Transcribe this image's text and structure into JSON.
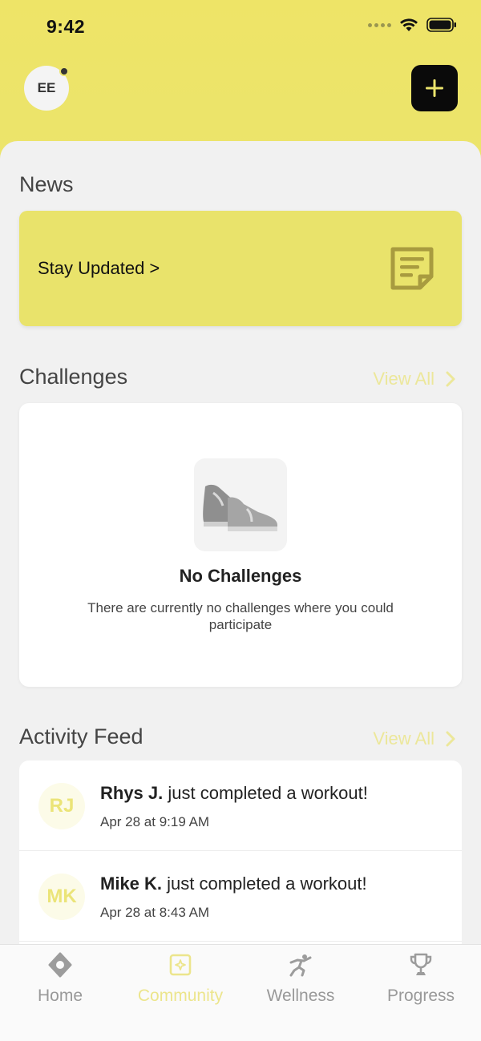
{
  "status_bar": {
    "time": "9:42"
  },
  "header": {
    "avatar_initials": "EE",
    "add_button_icon": "plus-icon"
  },
  "news": {
    "title": "News",
    "card_label": "Stay Updated >",
    "card_icon": "notepad-icon"
  },
  "challenges": {
    "title": "Challenges",
    "view_all": "View All",
    "empty_icon": "sneakers-icon",
    "empty_title": "No Challenges",
    "empty_description": "There are currently no challenges where you could participate"
  },
  "activity_feed": {
    "title": "Activity Feed",
    "view_all": "View All",
    "items": [
      {
        "initials": "RJ",
        "name": "Rhys J.",
        "action": " just completed a workout!",
        "time": "Apr 28 at 9:19 AM"
      },
      {
        "initials": "MK",
        "name": "Mike K.",
        "action": " just completed a workout!",
        "time": "Apr 28 at 8:43 AM"
      }
    ]
  },
  "tab_bar": {
    "tabs": [
      {
        "label": "Home",
        "icon": "home-icon",
        "active": false
      },
      {
        "label": "Community",
        "icon": "community-icon",
        "active": true
      },
      {
        "label": "Wellness",
        "icon": "wellness-icon",
        "active": false
      },
      {
        "label": "Progress",
        "icon": "trophy-icon",
        "active": false
      }
    ]
  },
  "colors": {
    "accent": "#EBE46C",
    "accent_light": "#ECE79A",
    "background": "#F1F1F1",
    "dark_button": "#0A0A0A"
  }
}
